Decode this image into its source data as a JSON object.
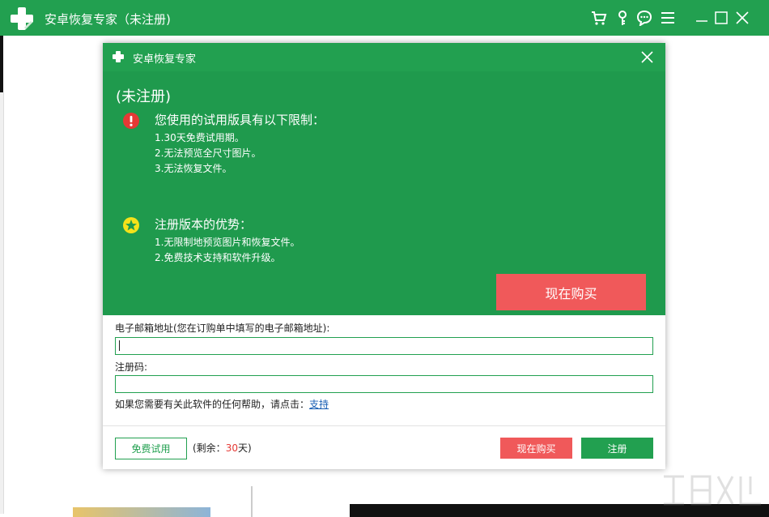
{
  "window": {
    "title": "安卓恢复专家（未注册)",
    "icons": [
      "cart-icon",
      "key-icon",
      "chat-icon",
      "menu-icon"
    ],
    "controls": [
      "minimize-icon",
      "maximize-icon",
      "close-icon"
    ]
  },
  "dialog": {
    "title": "安卓恢复专家",
    "status": "(未注册)",
    "limits": {
      "title": "您使用的试用版具有以下限制：",
      "items": [
        "1.30天免费试用期。",
        "2.无法预览全尺寸图片。",
        "3.无法恢复文件。"
      ]
    },
    "benefits": {
      "title": "注册版本的优势：",
      "items": [
        "1.无限制地预览图片和恢复文件。",
        "2.免费技术支持和软件升级。"
      ]
    },
    "buy_now_big": "现在购买",
    "email_label": "电子邮箱地址(您在订购单中填写的电子邮箱地址):",
    "email_value": "",
    "code_label": "注册码:",
    "code_value": "",
    "help_prefix": "如果您需要有关此软件的任何帮助，请点击：",
    "help_link": "支持",
    "trial_button": "免费试用",
    "remain_prefix": "(剩余：",
    "remain_days": "30",
    "remain_suffix": "天)",
    "buy_now_small": "现在购买",
    "register_button": "注册"
  },
  "colors": {
    "green": "#22a050",
    "green_panel": "#1f9a4d",
    "red": "#f0595a",
    "link": "#1a5fb4"
  }
}
